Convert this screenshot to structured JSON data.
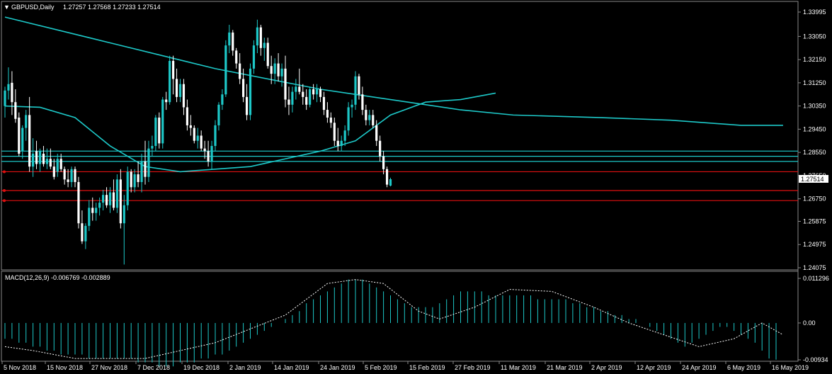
{
  "header": {
    "symbol": "GBPUSD,Daily",
    "ohlc": "1.27257 1.27568 1.27233 1.27514"
  },
  "macd": {
    "label": "MACD(12,26,9) -0.006769 -0.002889",
    "axis": [
      "0.011296",
      "0.00",
      "-0.00934"
    ]
  },
  "price_axis": [
    "1.33995",
    "1.33050",
    "1.32150",
    "1.31250",
    "1.30350",
    "1.29450",
    "1.28550",
    "1.27650",
    "1.26750",
    "1.25875",
    "1.24975",
    "1.24075"
  ],
  "current_price": "1.27514",
  "date_axis": [
    "5 Nov 2018",
    "15 Nov 2018",
    "27 Nov 2018",
    "7 Dec 2018",
    "19 Dec 2018",
    "2 Jan 2019",
    "14 Jan 2019",
    "24 Jan 2019",
    "5 Feb 2019",
    "15 Feb 2019",
    "27 Feb 2019",
    "11 Mar 2019",
    "21 Mar 2019",
    "2 Apr 2019",
    "12 Apr 2019",
    "24 Apr 2019",
    "6 May 2019",
    "16 May 2019"
  ],
  "colors": {
    "bull": "#1dc8c8",
    "bear": "#ffffff",
    "ma": "#1dc8c8",
    "level_red": "#e01010",
    "level_cyan": "#1dc8c8",
    "macd_signal": "#ffffff",
    "macd_hist": "#1dc8c8"
  },
  "chart_data": {
    "type": "candlestick",
    "ylim": [
      1.24075,
      1.33995
    ],
    "horizontal_levels_cyan": [
      1.286,
      1.284,
      1.282
    ],
    "horizontal_levels_red": [
      1.278,
      1.2707,
      1.2668
    ],
    "candles": [
      [
        1.3035,
        1.311,
        1.299,
        1.3095
      ],
      [
        1.3095,
        1.3185,
        1.306,
        1.312
      ],
      [
        1.3125,
        1.317,
        1.3,
        1.305
      ],
      [
        1.305,
        1.31,
        1.297,
        1.2985
      ],
      [
        1.299,
        1.301,
        1.284,
        1.285
      ],
      [
        1.286,
        1.296,
        1.283,
        1.295
      ],
      [
        1.295,
        1.302,
        1.29,
        1.3
      ],
      [
        1.3,
        1.307,
        1.278,
        1.28
      ],
      [
        1.28,
        1.291,
        1.276,
        1.285
      ],
      [
        1.286,
        1.29,
        1.279,
        1.281
      ],
      [
        1.281,
        1.287,
        1.278,
        1.286
      ],
      [
        1.285,
        1.288,
        1.28,
        1.281
      ],
      [
        1.281,
        1.287,
        1.279,
        1.283
      ],
      [
        1.283,
        1.287,
        1.279,
        1.28
      ],
      [
        1.28,
        1.283,
        1.275,
        1.276
      ],
      [
        1.278,
        1.285,
        1.276,
        1.283
      ],
      [
        1.283,
        1.285,
        1.278,
        1.279
      ],
      [
        1.279,
        1.28,
        1.273,
        1.275
      ],
      [
        1.275,
        1.279,
        1.272,
        1.274
      ],
      [
        1.274,
        1.28,
        1.272,
        1.279
      ],
      [
        1.279,
        1.28,
        1.272,
        1.274
      ],
      [
        1.274,
        1.276,
        1.256,
        1.258
      ],
      [
        1.258,
        1.263,
        1.25,
        1.251
      ],
      [
        1.251,
        1.258,
        1.248,
        1.257
      ],
      [
        1.257,
        1.267,
        1.255,
        1.264
      ],
      [
        1.264,
        1.268,
        1.259,
        1.262
      ],
      [
        1.262,
        1.266,
        1.259,
        1.264
      ],
      [
        1.264,
        1.268,
        1.261,
        1.266
      ],
      [
        1.266,
        1.271,
        1.263,
        1.269
      ],
      [
        1.269,
        1.272,
        1.264,
        1.265
      ],
      [
        1.265,
        1.272,
        1.262,
        1.27
      ],
      [
        1.27,
        1.275,
        1.263,
        1.264
      ],
      [
        1.264,
        1.277,
        1.262,
        1.275
      ],
      [
        1.275,
        1.279,
        1.256,
        1.258
      ],
      [
        1.258,
        1.269,
        1.242,
        1.265
      ],
      [
        1.265,
        1.28,
        1.263,
        1.278
      ],
      [
        1.278,
        1.279,
        1.27,
        1.272
      ],
      [
        1.272,
        1.279,
        1.27,
        1.277
      ],
      [
        1.277,
        1.282,
        1.272,
        1.274
      ],
      [
        1.274,
        1.285,
        1.27,
        1.282
      ],
      [
        1.282,
        1.29,
        1.273,
        1.276
      ],
      [
        1.276,
        1.29,
        1.274,
        1.287
      ],
      [
        1.287,
        1.292,
        1.284,
        1.288
      ],
      [
        1.288,
        1.3,
        1.286,
        1.299
      ],
      [
        1.299,
        1.301,
        1.287,
        1.289
      ],
      [
        1.289,
        1.307,
        1.287,
        1.306
      ],
      [
        1.306,
        1.309,
        1.302,
        1.305
      ],
      [
        1.305,
        1.323,
        1.304,
        1.321
      ],
      [
        1.321,
        1.323,
        1.308,
        1.314
      ],
      [
        1.314,
        1.318,
        1.305,
        1.307
      ],
      [
        1.307,
        1.314,
        1.305,
        1.312
      ],
      [
        1.312,
        1.314,
        1.3,
        1.303
      ],
      [
        1.303,
        1.306,
        1.294,
        1.296
      ],
      [
        1.296,
        1.3,
        1.292,
        1.295
      ],
      [
        1.295,
        1.296,
        1.289,
        1.29
      ],
      [
        1.29,
        1.295,
        1.287,
        1.292
      ],
      [
        1.292,
        1.294,
        1.286,
        1.287
      ],
      [
        1.287,
        1.29,
        1.283,
        1.286
      ],
      [
        1.286,
        1.29,
        1.28,
        1.282
      ],
      [
        1.282,
        1.29,
        1.279,
        1.288
      ],
      [
        1.288,
        1.298,
        1.286,
        1.296
      ],
      [
        1.296,
        1.305,
        1.294,
        1.304
      ],
      [
        1.304,
        1.31,
        1.302,
        1.308
      ],
      [
        1.308,
        1.329,
        1.307,
        1.327
      ],
      [
        1.327,
        1.335,
        1.324,
        1.332
      ],
      [
        1.332,
        1.333,
        1.323,
        1.325
      ],
      [
        1.325,
        1.326,
        1.318,
        1.32
      ],
      [
        1.32,
        1.324,
        1.312,
        1.314
      ],
      [
        1.314,
        1.318,
        1.305,
        1.307
      ],
      [
        1.307,
        1.312,
        1.298,
        1.3
      ],
      [
        1.3,
        1.32,
        1.298,
        1.318
      ],
      [
        1.318,
        1.329,
        1.316,
        1.327
      ],
      [
        1.327,
        1.337,
        1.324,
        1.334
      ],
      [
        1.334,
        1.335,
        1.323,
        1.326
      ],
      [
        1.326,
        1.33,
        1.321,
        1.328
      ],
      [
        1.328,
        1.33,
        1.318,
        1.319
      ],
      [
        1.319,
        1.323,
        1.312,
        1.316
      ],
      [
        1.316,
        1.322,
        1.312,
        1.32
      ],
      [
        1.32,
        1.324,
        1.313,
        1.315
      ],
      [
        1.315,
        1.32,
        1.311,
        1.318
      ],
      [
        1.318,
        1.323,
        1.303,
        1.306
      ],
      [
        1.306,
        1.311,
        1.3,
        1.304
      ],
      [
        1.304,
        1.311,
        1.301,
        1.309
      ],
      [
        1.309,
        1.314,
        1.306,
        1.311
      ],
      [
        1.311,
        1.318,
        1.308,
        1.309
      ],
      [
        1.309,
        1.312,
        1.304,
        1.307
      ],
      [
        1.307,
        1.31,
        1.302,
        1.304
      ],
      [
        1.304,
        1.311,
        1.303,
        1.31
      ],
      [
        1.31,
        1.312,
        1.306,
        1.308
      ],
      [
        1.308,
        1.312,
        1.305,
        1.31
      ],
      [
        1.31,
        1.311,
        1.305,
        1.307
      ],
      [
        1.307,
        1.309,
        1.3,
        1.302
      ],
      [
        1.302,
        1.305,
        1.297,
        1.299
      ],
      [
        1.299,
        1.301,
        1.295,
        1.297
      ],
      [
        1.297,
        1.299,
        1.288,
        1.29
      ],
      [
        1.29,
        1.295,
        1.286,
        1.288
      ],
      [
        1.288,
        1.292,
        1.286,
        1.29
      ],
      [
        1.29,
        1.296,
        1.288,
        1.294
      ],
      [
        1.294,
        1.305,
        1.292,
        1.303
      ],
      [
        1.303,
        1.306,
        1.299,
        1.304
      ],
      [
        1.304,
        1.317,
        1.302,
        1.315
      ],
      [
        1.315,
        1.316,
        1.306,
        1.308
      ],
      [
        1.308,
        1.311,
        1.3,
        1.302
      ],
      [
        1.302,
        1.304,
        1.296,
        1.298
      ],
      [
        1.298,
        1.302,
        1.296,
        1.3
      ],
      [
        1.3,
        1.302,
        1.295,
        1.296
      ],
      [
        1.296,
        1.298,
        1.288,
        1.29
      ],
      [
        1.29,
        1.292,
        1.282,
        1.284
      ],
      [
        1.284,
        1.286,
        1.277,
        1.279
      ],
      [
        1.279,
        1.28,
        1.272,
        1.273
      ],
      [
        1.2726,
        1.2757,
        1.2723,
        1.2751
      ]
    ],
    "ma_fast": [
      [
        0,
        1.3035
      ],
      [
        10,
        1.303
      ],
      [
        20,
        1.299
      ],
      [
        30,
        1.288
      ],
      [
        40,
        1.28
      ],
      [
        50,
        1.278
      ],
      [
        60,
        1.279
      ],
      [
        70,
        1.28
      ],
      [
        80,
        1.283
      ],
      [
        90,
        1.286
      ],
      [
        100,
        1.29
      ],
      [
        110,
        1.3
      ],
      [
        120,
        1.305
      ],
      [
        130,
        1.306
      ],
      [
        140,
        1.3085
      ]
    ],
    "ma_slow": [
      [
        0,
        1.338
      ],
      [
        30,
        1.328
      ],
      [
        60,
        1.318
      ],
      [
        90,
        1.31
      ],
      [
        110,
        1.306
      ],
      [
        130,
        1.302
      ],
      [
        145,
        1.3
      ],
      [
        170,
        1.299
      ],
      [
        190,
        1.298
      ],
      [
        210,
        1.296
      ],
      [
        222,
        1.296
      ]
    ],
    "macd_signal": [
      [
        0,
        -0.006
      ],
      [
        8,
        -0.007
      ],
      [
        20,
        -0.009
      ],
      [
        40,
        -0.009
      ],
      [
        60,
        -0.005
      ],
      [
        80,
        0.002
      ],
      [
        92,
        0.01
      ],
      [
        100,
        0.011
      ],
      [
        108,
        0.01
      ],
      [
        118,
        0.003
      ],
      [
        124,
        0.001
      ],
      [
        134,
        0.004
      ],
      [
        144,
        0.0085
      ],
      [
        156,
        0.008
      ],
      [
        168,
        0.004
      ],
      [
        178,
        0.0
      ],
      [
        188,
        -0.003
      ],
      [
        198,
        -0.006
      ],
      [
        208,
        -0.004
      ],
      [
        216,
        0.0
      ],
      [
        222,
        -0.003
      ]
    ],
    "macd_hist": [
      -0.004,
      -0.004,
      -0.005,
      -0.005,
      -0.006,
      -0.006,
      -0.007,
      -0.007,
      -0.008,
      -0.008,
      -0.008,
      -0.008,
      -0.009,
      -0.009,
      -0.009,
      -0.009,
      -0.009,
      -0.009,
      -0.009,
      -0.01,
      -0.01,
      -0.01,
      -0.011,
      -0.011,
      -0.011,
      -0.01,
      -0.01,
      -0.01,
      -0.009,
      -0.009,
      -0.008,
      -0.008,
      -0.007,
      -0.006,
      -0.005,
      -0.004,
      -0.003,
      -0.002,
      -0.001,
      0.0,
      0.001,
      0.002,
      0.003,
      0.005,
      0.006,
      0.007,
      0.008,
      0.009,
      0.01,
      0.011,
      0.011,
      0.011,
      0.01,
      0.009,
      0.008,
      0.007,
      0.006,
      0.005,
      0.004,
      0.004,
      0.004,
      0.004,
      0.005,
      0.006,
      0.007,
      0.008,
      0.008,
      0.008,
      0.008,
      0.007,
      0.007,
      0.007,
      0.007,
      0.007,
      0.007,
      0.007,
      0.006,
      0.006,
      0.006,
      0.006,
      0.006,
      0.005,
      0.005,
      0.004,
      0.004,
      0.003,
      0.003,
      0.002,
      0.002,
      0.001,
      0.001,
      0.0,
      -0.001,
      -0.002,
      -0.003,
      -0.004,
      -0.005,
      -0.006,
      -0.005,
      -0.004,
      -0.003,
      -0.002,
      -0.001,
      -0.001,
      -0.002,
      -0.003,
      -0.004,
      -0.005,
      -0.007,
      -0.009,
      -0.0093
    ]
  }
}
